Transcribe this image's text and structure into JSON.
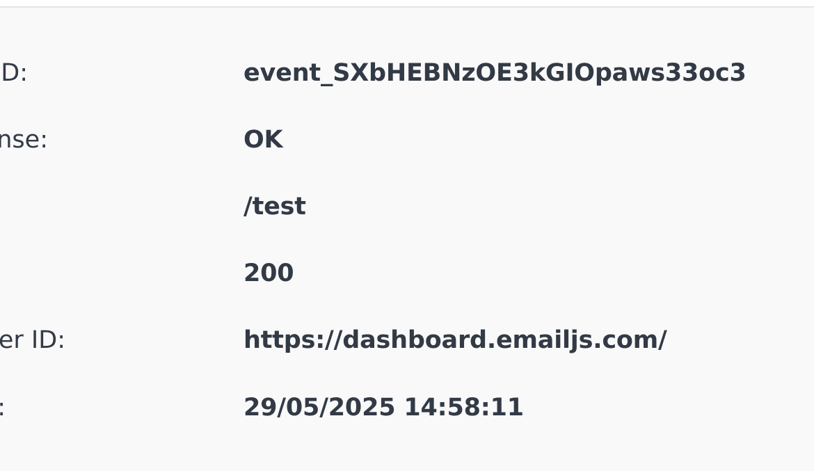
{
  "details": {
    "rows": [
      {
        "label": "D:",
        "value": "event_SXbHEBNzOE3kGIOpaws33oc3"
      },
      {
        "label": "nse:",
        "value": "OK"
      },
      {
        "label": "",
        "value": "/test"
      },
      {
        "label": "",
        "value": "200"
      },
      {
        "label": "er ID:",
        "value": "https://dashboard.emailjs.com/"
      },
      {
        "label": ":",
        "value": "29/05/2025 14:58:11"
      }
    ]
  },
  "colors": {
    "background": "#f9f9fa",
    "text": "#323a45",
    "divider": "#e3e5e8"
  }
}
